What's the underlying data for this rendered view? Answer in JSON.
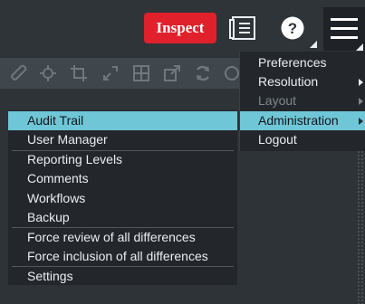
{
  "header": {
    "inspect_label": "Inspect",
    "icons": [
      "notes-icon",
      "help-icon",
      "hamburger-menu-icon"
    ]
  },
  "toolbar": {
    "icons": [
      "ruler-icon",
      "crosshair-icon",
      "crop-icon",
      "expand-icon",
      "grid-icon",
      "resize-icon",
      "refresh-icon",
      "search-icon"
    ]
  },
  "main_menu": {
    "items": [
      {
        "label": "Preferences",
        "has_submenu": false,
        "state": "normal"
      },
      {
        "label": "Resolution",
        "has_submenu": true,
        "state": "normal"
      },
      {
        "label": "Layout",
        "has_submenu": true,
        "state": "disabled"
      },
      {
        "label": "Administration",
        "has_submenu": true,
        "state": "active"
      },
      {
        "label": "Logout",
        "has_submenu": false,
        "state": "normal"
      }
    ]
  },
  "admin_submenu": {
    "items": [
      {
        "label": "Audit Trail",
        "state": "active"
      },
      {
        "label": "User Manager",
        "state": "normal"
      },
      {
        "label": "Reporting Levels",
        "state": "normal"
      },
      {
        "label": "Comments",
        "state": "normal"
      },
      {
        "label": "Workflows",
        "state": "normal"
      },
      {
        "label": "Backup",
        "state": "normal"
      },
      {
        "label": "Force review of all differences",
        "state": "normal"
      },
      {
        "label": "Force inclusion of all differences",
        "state": "normal"
      },
      {
        "label": "Settings",
        "state": "normal"
      }
    ]
  },
  "colors": {
    "accent": "#6fc6d7",
    "inspect_red": "#e0202a",
    "menu_bg": "#23272b",
    "page_bg": "#2e3338"
  }
}
